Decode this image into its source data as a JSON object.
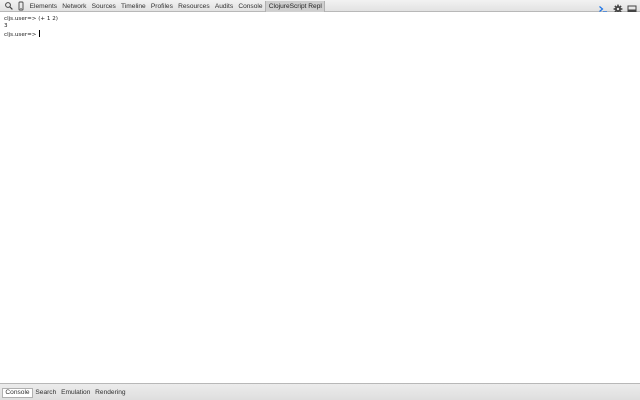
{
  "toolbar": {
    "left_icons": [
      "search-icon",
      "device-mode-icon"
    ],
    "tabs": [
      {
        "label": "Elements"
      },
      {
        "label": "Network"
      },
      {
        "label": "Sources"
      },
      {
        "label": "Timeline"
      },
      {
        "label": "Profiles"
      },
      {
        "label": "Resources"
      },
      {
        "label": "Audits"
      },
      {
        "label": "Console"
      },
      {
        "label": "ClojureScript Repl"
      }
    ],
    "active_tab": "ClojureScript Repl",
    "right_icons": [
      "show-console-drawer-icon",
      "gear-icon",
      "dock-side-icon"
    ]
  },
  "console": {
    "lines": [
      {
        "text": "cljs.user=> (+ 1 2)"
      },
      {
        "text": "3"
      },
      {
        "text": "cljs.user=> "
      }
    ]
  },
  "drawer": {
    "tabs": [
      {
        "label": "Console"
      },
      {
        "label": "Search"
      },
      {
        "label": "Emulation"
      },
      {
        "label": "Rendering"
      }
    ],
    "active_tab": "Console"
  },
  "colors": {
    "toolbar_bg": "#e8e8e8",
    "active_tab_bg": "#cfcfcf",
    "console_prompt_icon": "#1a73e8"
  }
}
